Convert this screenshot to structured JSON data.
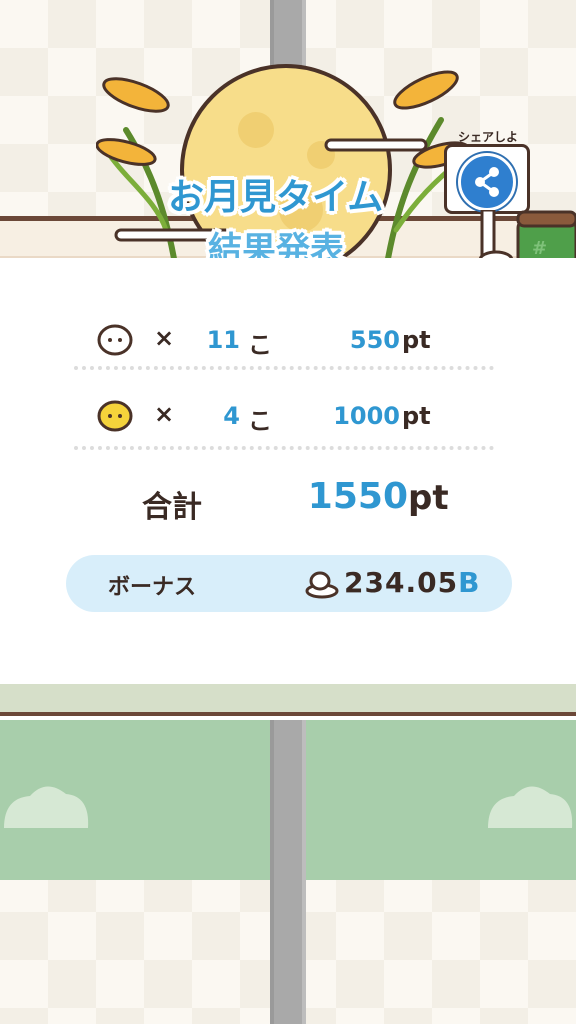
{
  "header": {
    "title_line1": "お月見タイム",
    "title_line2": "結果発表",
    "share_caption": "シェアしよ",
    "share_icon": "share-icon"
  },
  "results": {
    "rows": [
      {
        "icon": "white-mochi-icon",
        "times": "×",
        "count": "11",
        "count_unit": "こ",
        "points": "550",
        "points_unit": "pt"
      },
      {
        "icon": "yellow-mochi-icon",
        "times": "×",
        "count": "4",
        "count_unit": "こ",
        "points": "1000",
        "points_unit": "pt"
      }
    ],
    "total_label": "合計",
    "total_value": "1550",
    "total_unit": "pt"
  },
  "bonus": {
    "label": "ボーナス",
    "icon": "mochi-stack-icon",
    "value": "234.05",
    "unit": "B"
  },
  "colors": {
    "accent_blue": "#2f97d1",
    "text_dark": "#3a2a24",
    "bonus_bg": "#d8eefa",
    "moon": "#f7dd8a",
    "tatami_green": "#a8ceab"
  }
}
